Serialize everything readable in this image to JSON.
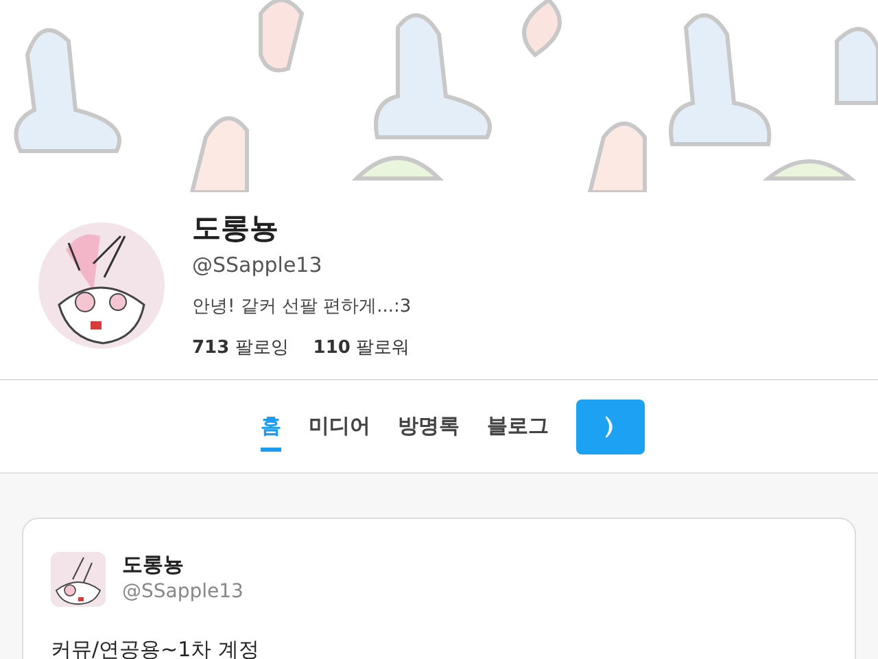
{
  "profile": {
    "name": "도롱뇽",
    "handle": "@SSapple13",
    "bio": "안녕! 같커 선팔 편하게...:3",
    "following_count": "713",
    "following_label": "팔로잉",
    "followers_count": "110",
    "followers_label": "팔로워"
  },
  "tabs": [
    {
      "label": "홈",
      "selected": true
    },
    {
      "label": "미디어",
      "selected": false
    },
    {
      "label": "방명록",
      "selected": false
    },
    {
      "label": "블로그",
      "selected": false
    }
  ],
  "posts": [
    {
      "name": "도롱뇽",
      "handle": "@SSapple13",
      "text": "커뮤/연공용~1차 계정"
    }
  ]
}
